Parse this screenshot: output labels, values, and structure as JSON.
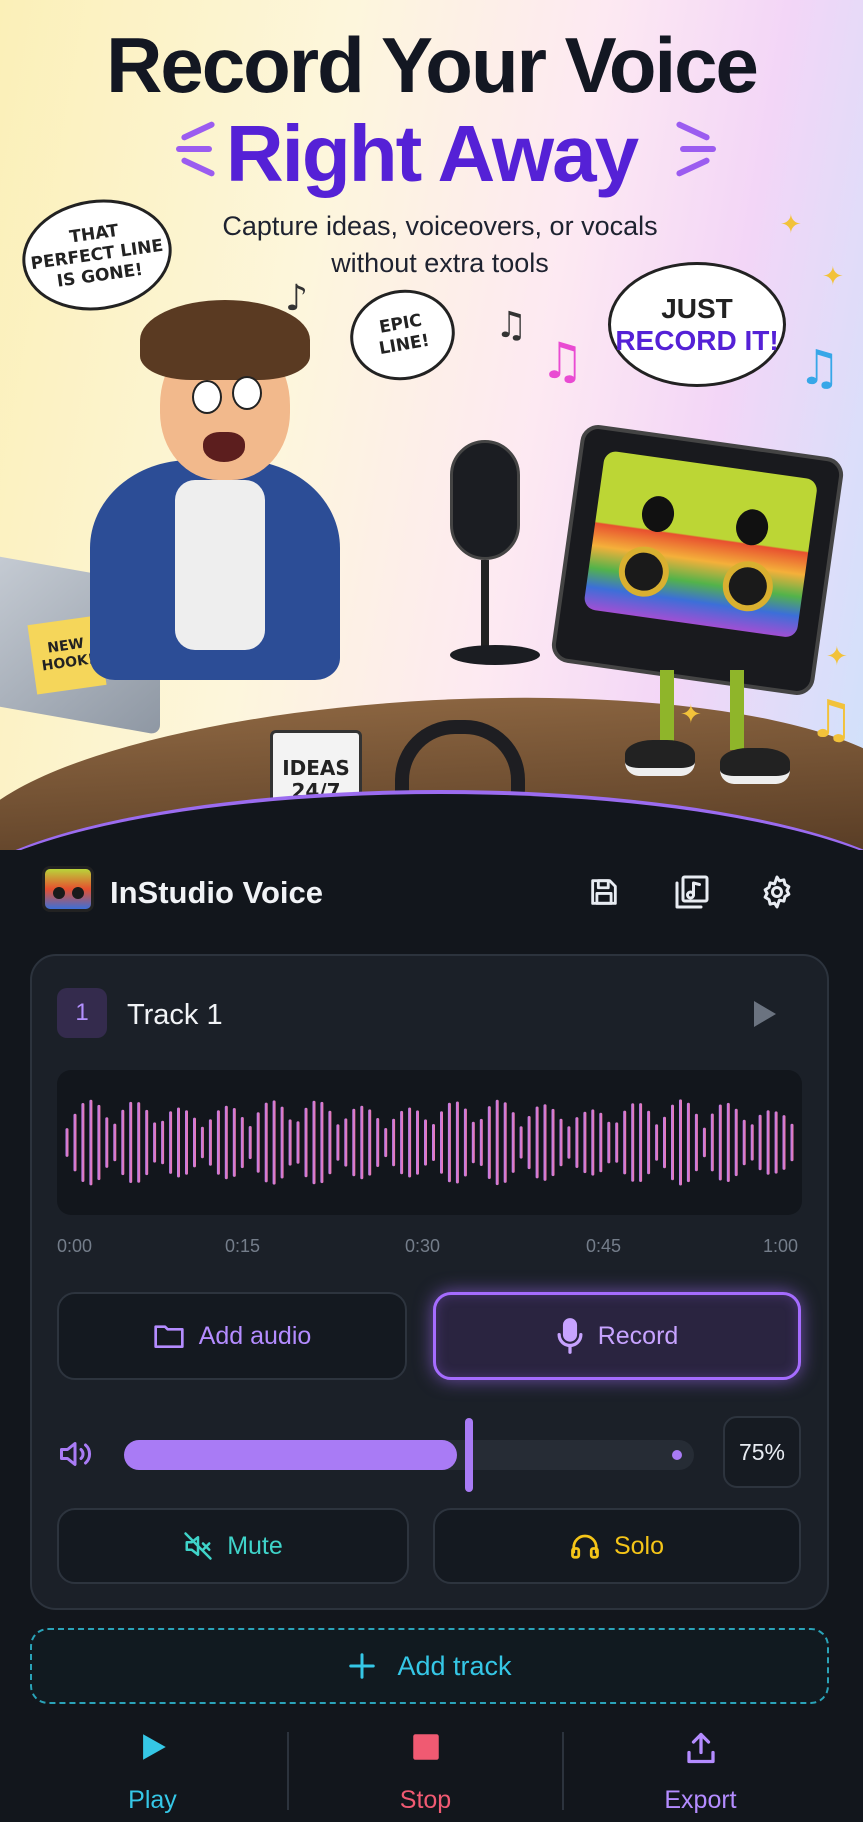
{
  "hero": {
    "title_line1": "Record Your Voice",
    "title_line2": "Right Away",
    "subtitle_line1": "Capture ideas, voiceovers, or vocals",
    "subtitle_line2": "without extra tools",
    "bubble_gone": [
      "THAT",
      "PERFECT LINE",
      "IS GONE!"
    ],
    "bubble_epic": [
      "EPIC",
      "LINE!"
    ],
    "bubble_just": [
      "JUST",
      "RECORD IT!"
    ],
    "sticky_note": [
      "NEW",
      "HOOK!"
    ],
    "mug_text": [
      "IDEAS",
      "24/7"
    ]
  },
  "app": {
    "title": "InStudio Voice",
    "icons": [
      "save-icon",
      "music-library-icon",
      "settings-gear-icon"
    ]
  },
  "track": {
    "number": "1",
    "name": "Track 1",
    "timeline": [
      "0:00",
      "0:15",
      "0:30",
      "0:45",
      "1:00"
    ],
    "add_audio_label": "Add audio",
    "record_label": "Record",
    "volume_percent": 75,
    "volume_label": "75%",
    "mute_label": "Mute",
    "solo_label": "Solo"
  },
  "add_track_label": "Add track",
  "nav": {
    "play_label": "Play",
    "stop_label": "Stop",
    "export_label": "Export"
  },
  "colors": {
    "accent_purple": "#a97bf5",
    "wave_start": "#b67cf4",
    "wave_end": "#f27aa8",
    "teal": "#3fd3c9",
    "gold": "#f5c518",
    "cyan": "#35c7e6",
    "stop_red": "#f05a72"
  }
}
